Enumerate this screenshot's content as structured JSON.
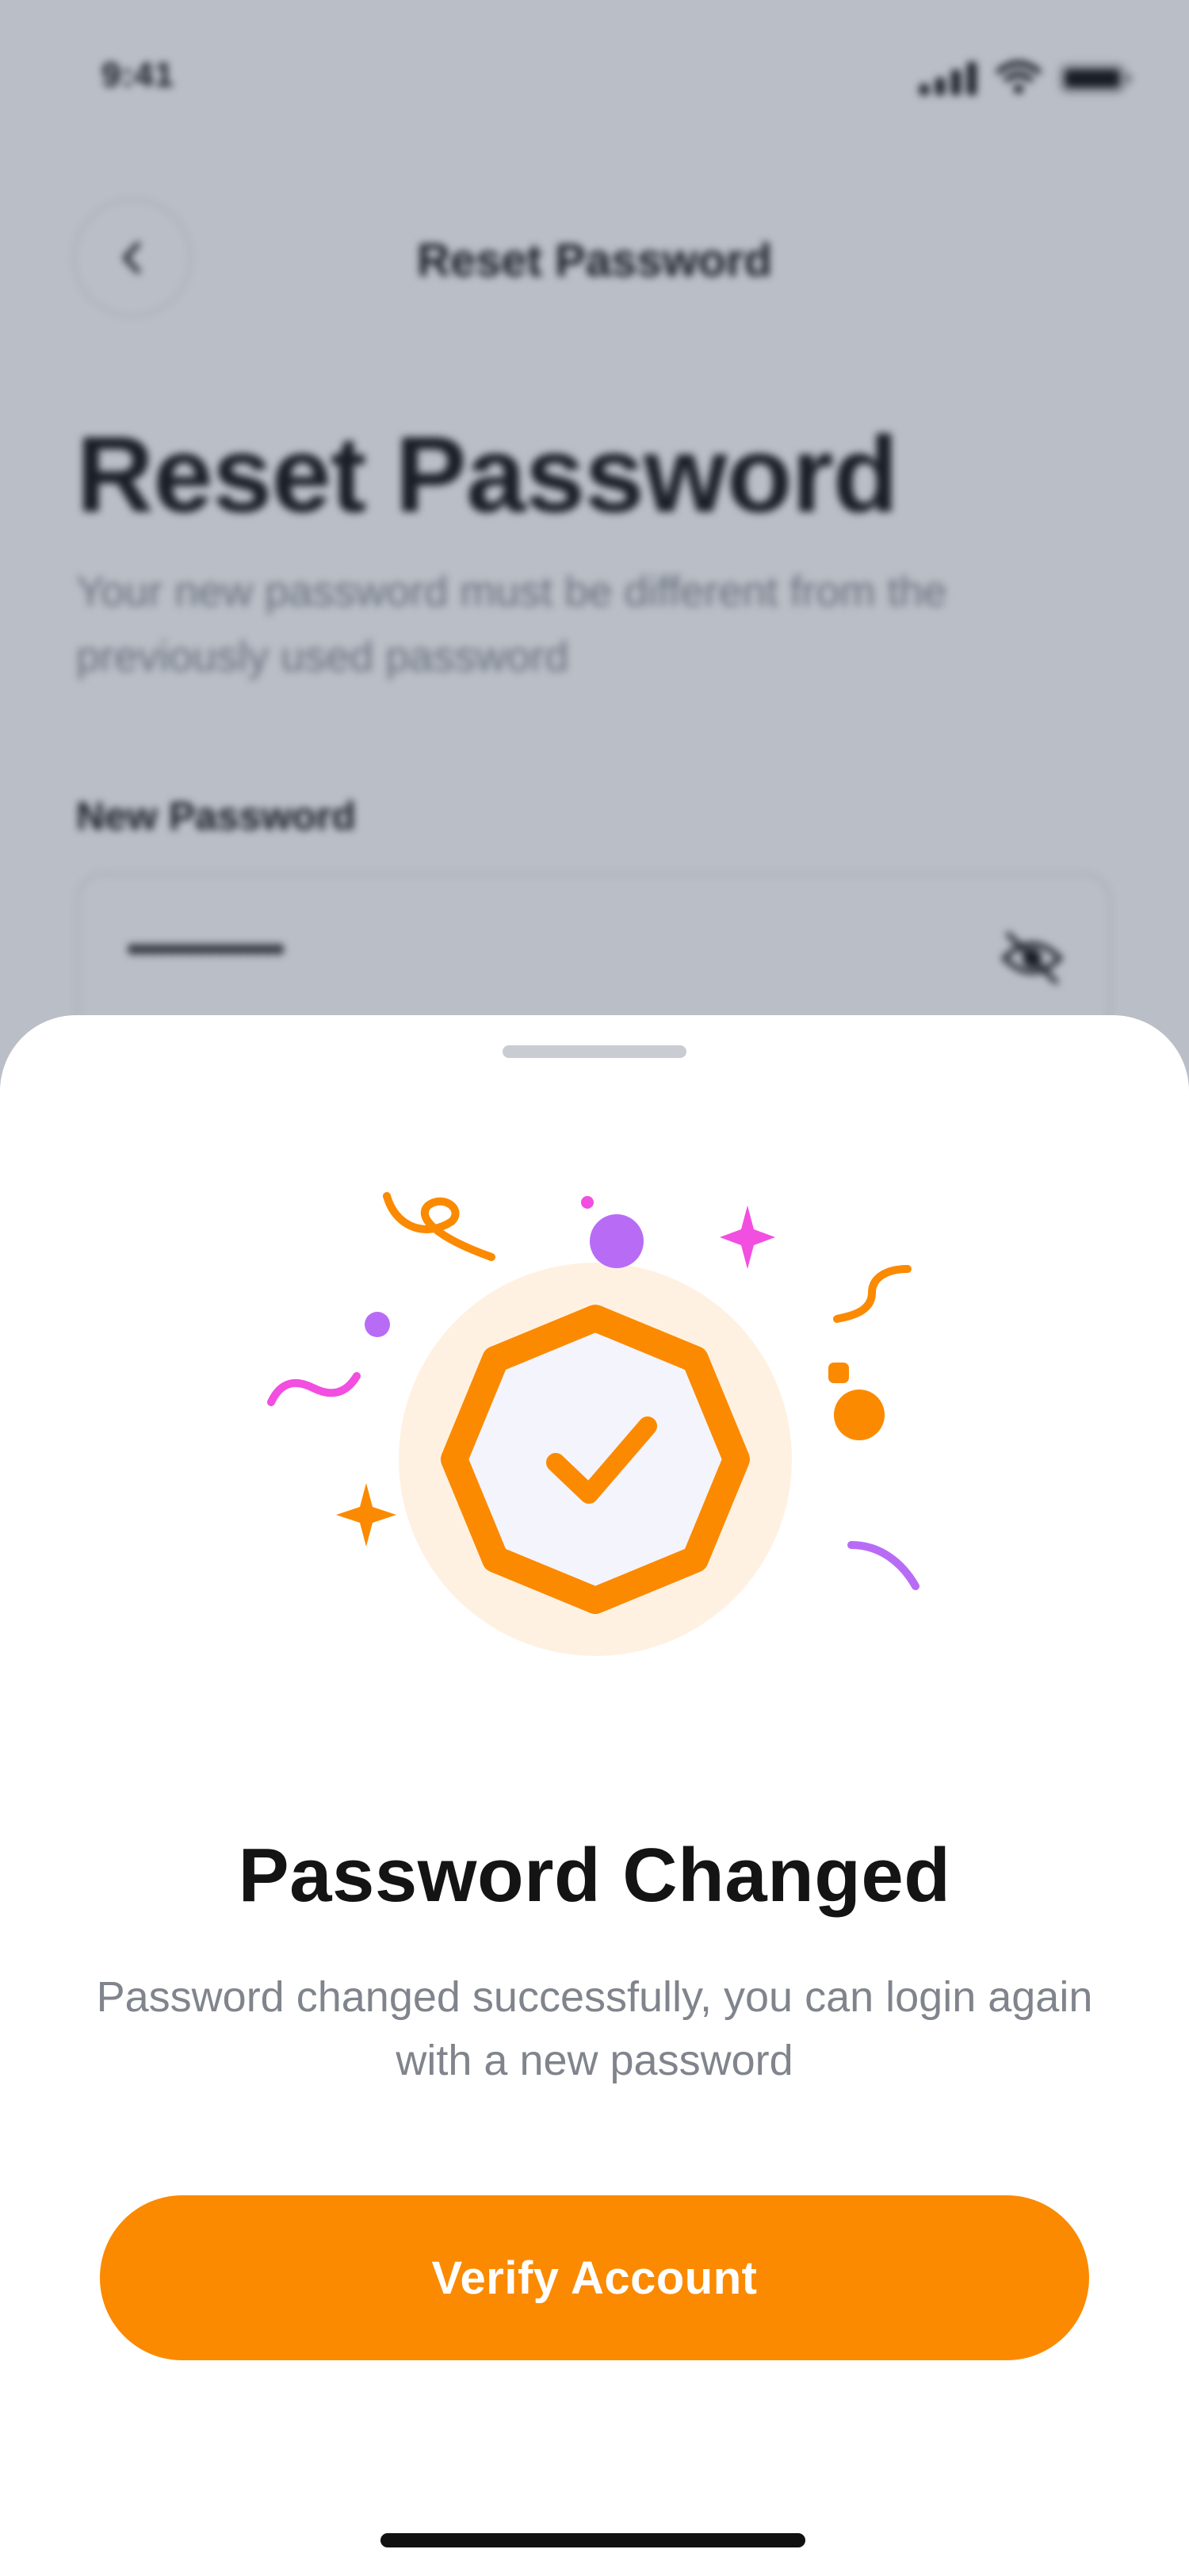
{
  "status_bar": {
    "time": "9:41"
  },
  "background_page": {
    "nav_title": "Reset Password",
    "heading": "Reset Password",
    "subtitle": "Your new password must be different from the previously used password",
    "field_label": "New Password",
    "field_value": "••••••••••••••••"
  },
  "sheet": {
    "title": "Password Changed",
    "message": "Password changed successfully, you can login again with a new password",
    "button_label": "Verify Account"
  },
  "colors": {
    "accent": "#fb8a00",
    "confetti_purple": "#b86cf6",
    "confetti_pink": "#f24ee0",
    "badge_halo": "#fff1e2",
    "badge_fill": "#f4f4fc"
  }
}
